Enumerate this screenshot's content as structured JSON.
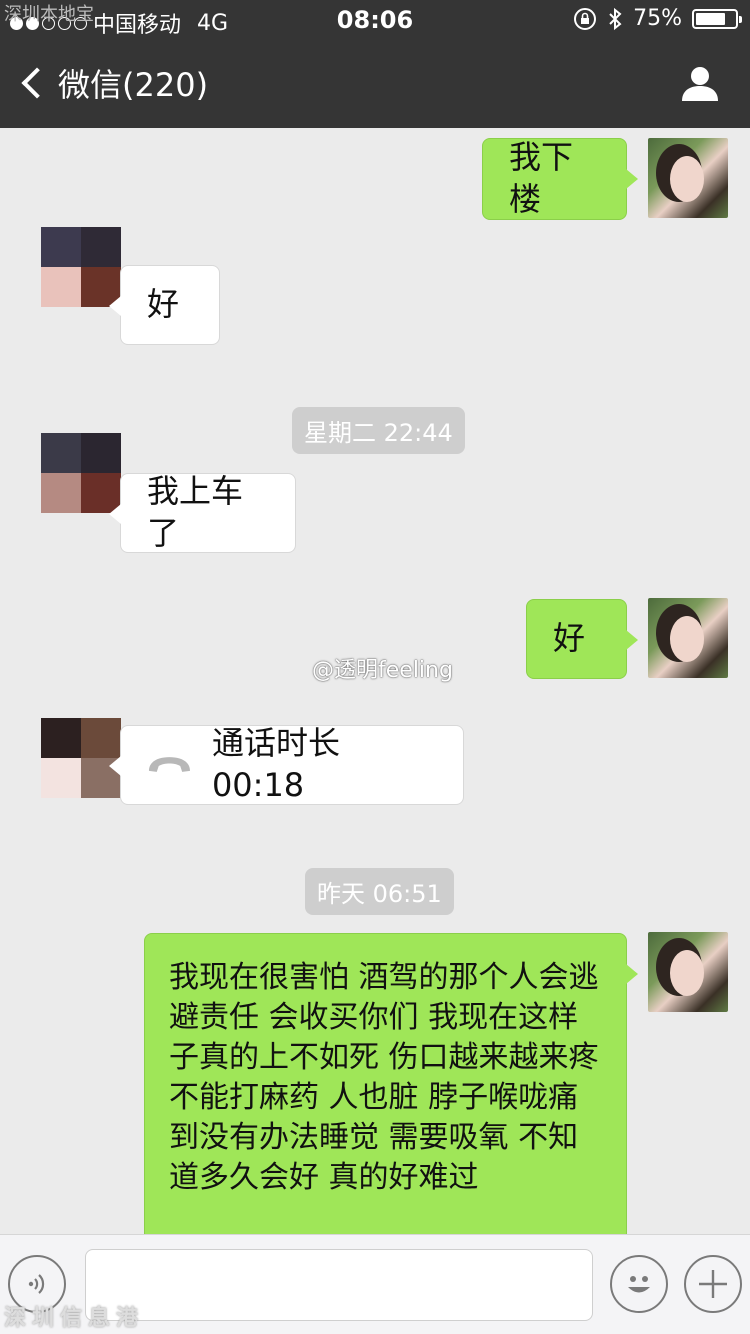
{
  "status_bar": {
    "carrier": "中国移动",
    "network": "4G",
    "time": "08:06",
    "battery": "75%",
    "battery_level": 0.75
  },
  "nav": {
    "back_label": "微信(220)"
  },
  "messages": [
    {
      "from": "me",
      "text": "我下楼"
    },
    {
      "from": "other",
      "text": "好"
    },
    {
      "type": "timestamp",
      "text": "星期二 22:44"
    },
    {
      "from": "other",
      "text": "我上车了"
    },
    {
      "from": "me",
      "text": "好"
    },
    {
      "from": "other",
      "type": "call",
      "text": "通话时长 00:18"
    },
    {
      "type": "timestamp",
      "text": "昨天 06:51"
    },
    {
      "from": "me",
      "text": "我现在很害怕 酒驾的那个人会逃避责任 会收买你们 我现在这样子真的上不如死 伤口越来越来疼 不能打麻药 人也脏 脖子喉咙痛到没有办法睡觉 需要吸氧 不知道多久会好 真的好难过"
    }
  ],
  "watermark": "@透明feeling",
  "corner_watermark": "深圳本地宝",
  "bottom_watermark": "深圳信息港",
  "colors": {
    "nav_bg": "#353535",
    "chat_bg": "#ebebeb",
    "my_bubble": "#9fe658",
    "their_bubble": "#ffffff"
  }
}
